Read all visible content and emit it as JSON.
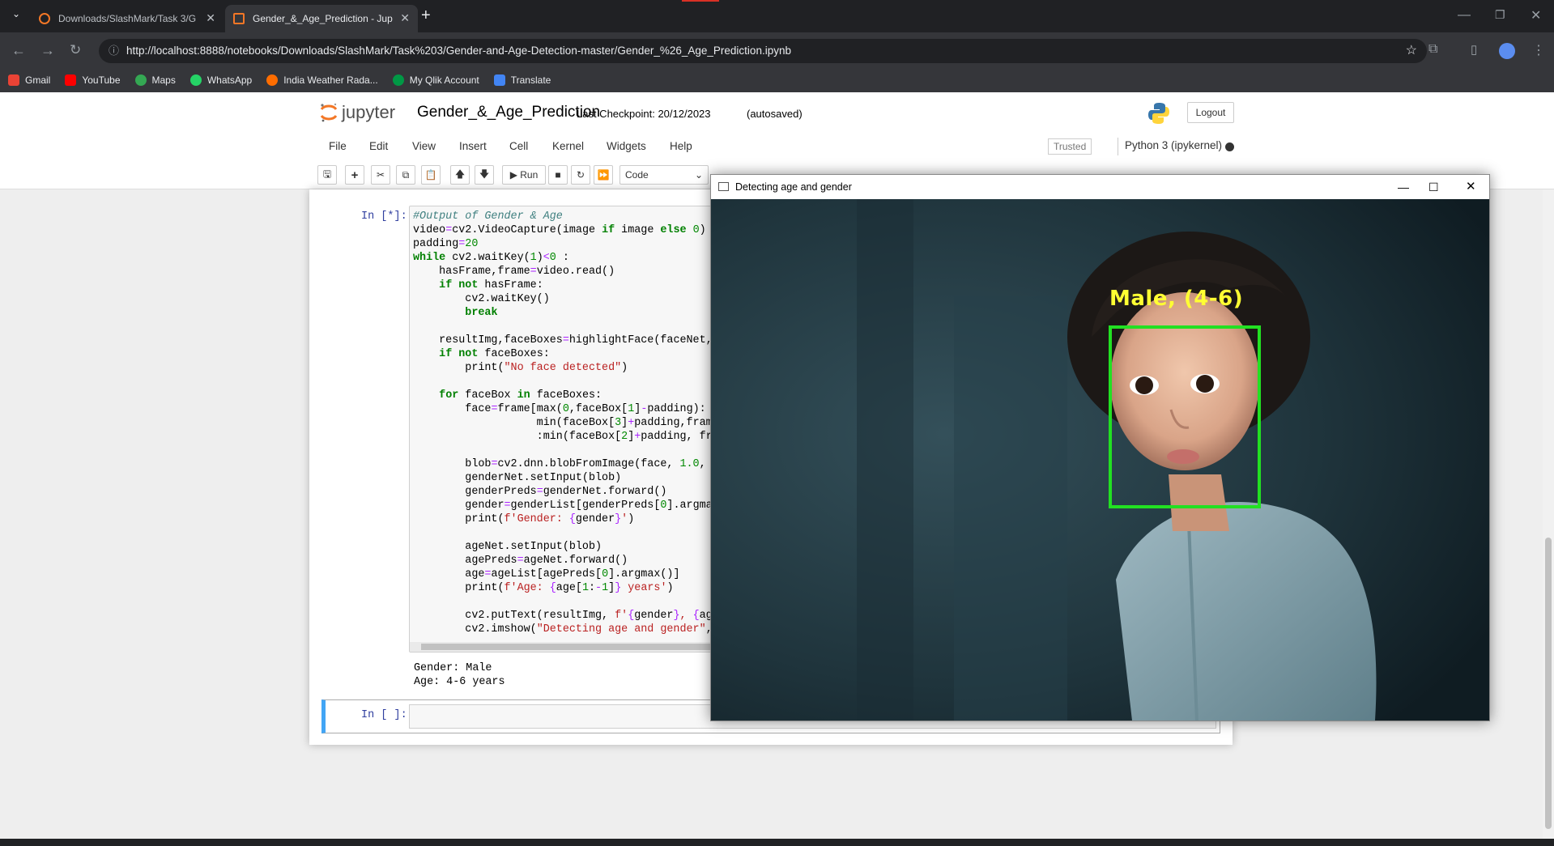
{
  "browser": {
    "tabs": [
      {
        "title": "Downloads/SlashMark/Task 3/G"
      },
      {
        "title": "Gender_&_Age_Prediction - Jup"
      }
    ],
    "url": "http://localhost:8888/notebooks/Downloads/SlashMark/Task%203/Gender-and-Age-Detection-master/Gender_%26_Age_Prediction.ipynb",
    "bookmarks": [
      {
        "label": "Gmail",
        "color": "#ea4335"
      },
      {
        "label": "YouTube",
        "color": "#ff0000"
      },
      {
        "label": "Maps",
        "color": "#34a853"
      },
      {
        "label": "WhatsApp",
        "color": "#25d366"
      },
      {
        "label": "India Weather Rada...",
        "color": "#ff6d00"
      },
      {
        "label": "My Qlik Account",
        "color": "#009845"
      },
      {
        "label": "Translate",
        "color": "#4285f4"
      }
    ]
  },
  "jupyter": {
    "logo_text": "jupyter",
    "notebook_name": "Gender_&_Age_Prediction",
    "checkpoint": "Last Checkpoint: 20/12/2023",
    "autosave": "(autosaved)",
    "logout": "Logout",
    "menus": [
      "File",
      "Edit",
      "View",
      "Insert",
      "Cell",
      "Kernel",
      "Widgets",
      "Help"
    ],
    "trusted": "Trusted",
    "kernel": "Python 3 (ipykernel)",
    "toolbar": {
      "run": "Run",
      "cell_type": "Code"
    },
    "cells": {
      "prompt_running": "In [*]:",
      "prompt_empty": "In [ ]:",
      "output": [
        "Gender: Male",
        "Age: 4-6 years"
      ]
    }
  },
  "cv_window": {
    "title": "Detecting age and gender",
    "label": "Male, (4-6)",
    "box_color": "#22e022",
    "label_color": "#ffff33"
  }
}
